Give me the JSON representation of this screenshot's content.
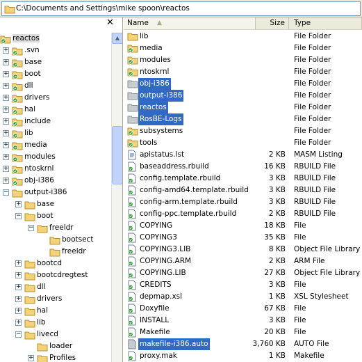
{
  "address": {
    "path": "C:\\Documents and Settings\\mike spoon\\reactos"
  },
  "tree": {
    "close_glyph": "✕",
    "items": [
      {
        "label": "reactos",
        "depth": 0,
        "expander": "",
        "selected": true
      },
      {
        "label": ".svn",
        "depth": 1,
        "expander": "+"
      },
      {
        "label": "base",
        "depth": 1,
        "expander": "+"
      },
      {
        "label": "boot",
        "depth": 1,
        "expander": "+"
      },
      {
        "label": "dll",
        "depth": 1,
        "expander": "+"
      },
      {
        "label": "drivers",
        "depth": 1,
        "expander": "+"
      },
      {
        "label": "hal",
        "depth": 1,
        "expander": "+"
      },
      {
        "label": "include",
        "depth": 1,
        "expander": "+"
      },
      {
        "label": "lib",
        "depth": 1,
        "expander": "+"
      },
      {
        "label": "media",
        "depth": 1,
        "expander": "+"
      },
      {
        "label": "modules",
        "depth": 1,
        "expander": "+"
      },
      {
        "label": "ntoskrnl",
        "depth": 1,
        "expander": "+"
      },
      {
        "label": "obj-i386",
        "depth": 1,
        "expander": "+"
      },
      {
        "label": "output-i386",
        "depth": 1,
        "expander": "-"
      },
      {
        "label": "base",
        "depth": 2,
        "expander": "+"
      },
      {
        "label": "boot",
        "depth": 2,
        "expander": "-"
      },
      {
        "label": "freeldr",
        "depth": 3,
        "expander": "-"
      },
      {
        "label": "bootsect",
        "depth": 4,
        "expander": ""
      },
      {
        "label": "freeldr",
        "depth": 4,
        "expander": ""
      },
      {
        "label": "bootcd",
        "depth": 2,
        "expander": "+"
      },
      {
        "label": "bootcdregtest",
        "depth": 2,
        "expander": "+"
      },
      {
        "label": "dll",
        "depth": 2,
        "expander": "+"
      },
      {
        "label": "drivers",
        "depth": 2,
        "expander": "+"
      },
      {
        "label": "hal",
        "depth": 2,
        "expander": "+"
      },
      {
        "label": "lib",
        "depth": 2,
        "expander": "+"
      },
      {
        "label": "livecd",
        "depth": 2,
        "expander": "-"
      },
      {
        "label": "loader",
        "depth": 3,
        "expander": ""
      },
      {
        "label": "Profiles",
        "depth": 3,
        "expander": "+"
      }
    ]
  },
  "list": {
    "columns": {
      "name": "Name",
      "size": "Size",
      "type": "Type"
    },
    "rows": [
      {
        "name": "lib",
        "size": "",
        "type": "File Folder",
        "icon": "folder",
        "selected": false
      },
      {
        "name": "media",
        "size": "",
        "type": "File Folder",
        "icon": "folder-svn",
        "selected": false
      },
      {
        "name": "modules",
        "size": "",
        "type": "File Folder",
        "icon": "folder-svn",
        "selected": false
      },
      {
        "name": "ntoskrnl",
        "size": "",
        "type": "File Folder",
        "icon": "folder-svn",
        "selected": false
      },
      {
        "name": "obj-i386",
        "size": "",
        "type": "File Folder",
        "icon": "folder-gray",
        "selected": true
      },
      {
        "name": "output-i386",
        "size": "",
        "type": "File Folder",
        "icon": "folder-gray",
        "selected": true
      },
      {
        "name": "reactos",
        "size": "",
        "type": "File Folder",
        "icon": "folder-gray",
        "selected": true
      },
      {
        "name": "RosBE-Logs",
        "size": "",
        "type": "File Folder",
        "icon": "folder-gray",
        "selected": true
      },
      {
        "name": "subsystems",
        "size": "",
        "type": "File Folder",
        "icon": "folder-svn",
        "selected": false
      },
      {
        "name": "tools",
        "size": "",
        "type": "File Folder",
        "icon": "folder-svn",
        "selected": false
      },
      {
        "name": "apistatus.lst",
        "size": "2 KB",
        "type": "MASM Listing",
        "icon": "file-doc",
        "selected": false
      },
      {
        "name": "baseaddress.rbuild",
        "size": "16 KB",
        "type": "RBUILD File",
        "icon": "file-svn",
        "selected": false
      },
      {
        "name": "config.template.rbuild",
        "size": "3 KB",
        "type": "RBUILD File",
        "icon": "file-svn",
        "selected": false
      },
      {
        "name": "config-amd64.template.rbuild",
        "size": "3 KB",
        "type": "RBUILD File",
        "icon": "file-svn",
        "selected": false
      },
      {
        "name": "config-arm.template.rbuild",
        "size": "3 KB",
        "type": "RBUILD File",
        "icon": "file-svn",
        "selected": false
      },
      {
        "name": "config-ppc.template.rbuild",
        "size": "2 KB",
        "type": "RBUILD File",
        "icon": "file-svn",
        "selected": false
      },
      {
        "name": "COPYING",
        "size": "18 KB",
        "type": "File",
        "icon": "file-svn",
        "selected": false
      },
      {
        "name": "COPYING3",
        "size": "35 KB",
        "type": "File",
        "icon": "file-svn",
        "selected": false
      },
      {
        "name": "COPYING3.LIB",
        "size": "8 KB",
        "type": "Object File Library",
        "icon": "file-svn",
        "selected": false
      },
      {
        "name": "COPYING.ARM",
        "size": "2 KB",
        "type": "ARM File",
        "icon": "file-svn",
        "selected": false
      },
      {
        "name": "COPYING.LIB",
        "size": "27 KB",
        "type": "Object File Library",
        "icon": "file-svn",
        "selected": false
      },
      {
        "name": "CREDITS",
        "size": "3 KB",
        "type": "File",
        "icon": "file-svn",
        "selected": false
      },
      {
        "name": "depmap.xsl",
        "size": "1 KB",
        "type": "XSL Stylesheet",
        "icon": "file-svn",
        "selected": false
      },
      {
        "name": "Doxyfile",
        "size": "67 KB",
        "type": "File",
        "icon": "file-svn",
        "selected": false
      },
      {
        "name": "INSTALL",
        "size": "3 KB",
        "type": "File",
        "icon": "file-svn",
        "selected": false
      },
      {
        "name": "Makefile",
        "size": "20 KB",
        "type": "File",
        "icon": "file-svn",
        "selected": false
      },
      {
        "name": "makefile-i386.auto",
        "size": "3,760 KB",
        "type": "AUTO File",
        "icon": "file-gray",
        "selected": true
      },
      {
        "name": "proxy.mak",
        "size": "1 KB",
        "type": "Makefile",
        "icon": "file-svn",
        "selected": false
      }
    ]
  }
}
